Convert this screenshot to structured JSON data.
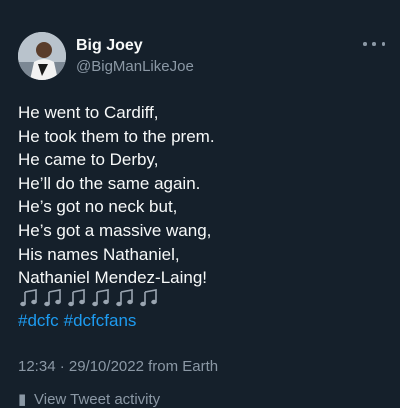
{
  "tweet": {
    "author": {
      "display_name": "Big Joey",
      "handle": "@BigManLikeJoe",
      "avatar_icon": "avatar-photo"
    },
    "lines": [
      "He went to Cardiff,",
      "He took them to the prem.",
      "He came to Derby,",
      "He’ll do the same again.",
      "He’s got no neck but,",
      "He’s got a massive wang,",
      "His names Nathaniel,",
      "Nathaniel Mendez-Laing!"
    ],
    "music_notes": [
      "🎶",
      "🎶",
      "🎶",
      "🎶",
      "🎶",
      "🎶"
    ],
    "hashtags": [
      "#dcfc",
      "#dcfcfans"
    ],
    "timestamp": "12:34 · 29/10/2022 from Earth",
    "activity_label": "View Tweet activity"
  },
  "colors": {
    "background": "#15202b",
    "text": "#f7f9f9",
    "secondary": "#8b98a5",
    "link": "#1d9bf0"
  }
}
